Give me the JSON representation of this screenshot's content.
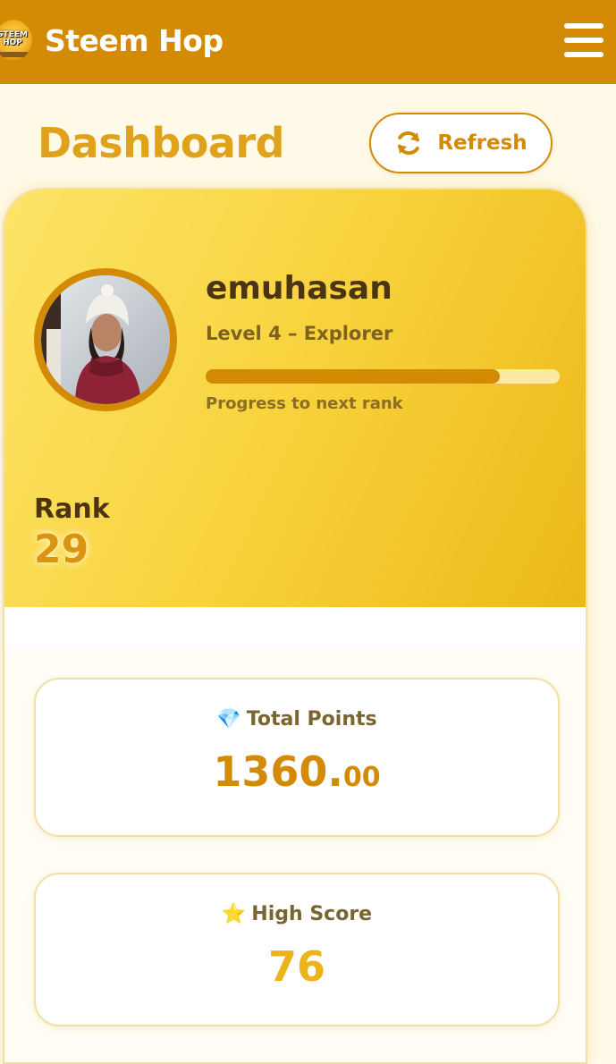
{
  "header": {
    "logo": {
      "line1": "STEEM",
      "line2": "HOP"
    },
    "brand": "Steem Hop",
    "menu_icon": "hamburger-menu-icon"
  },
  "page": {
    "title": "Dashboard",
    "refresh_label": "Refresh",
    "refresh_icon": "sync-icon"
  },
  "profile": {
    "username": "emuhasan",
    "level": "Level 4 – Explorer",
    "progress": 0.83,
    "progress_label": "Progress to next rank",
    "rank_label": "Rank",
    "rank_value": "29"
  },
  "stats": {
    "total_points": {
      "icon": "💎",
      "label": "Total Points",
      "integer": "1360.",
      "decimal": "00"
    },
    "high_score": {
      "icon": "⭐",
      "label": "High Score",
      "value": "76"
    }
  },
  "colors": {
    "accent": "#d38a05",
    "gold": "#f8d23c",
    "background": "#fffae8"
  }
}
